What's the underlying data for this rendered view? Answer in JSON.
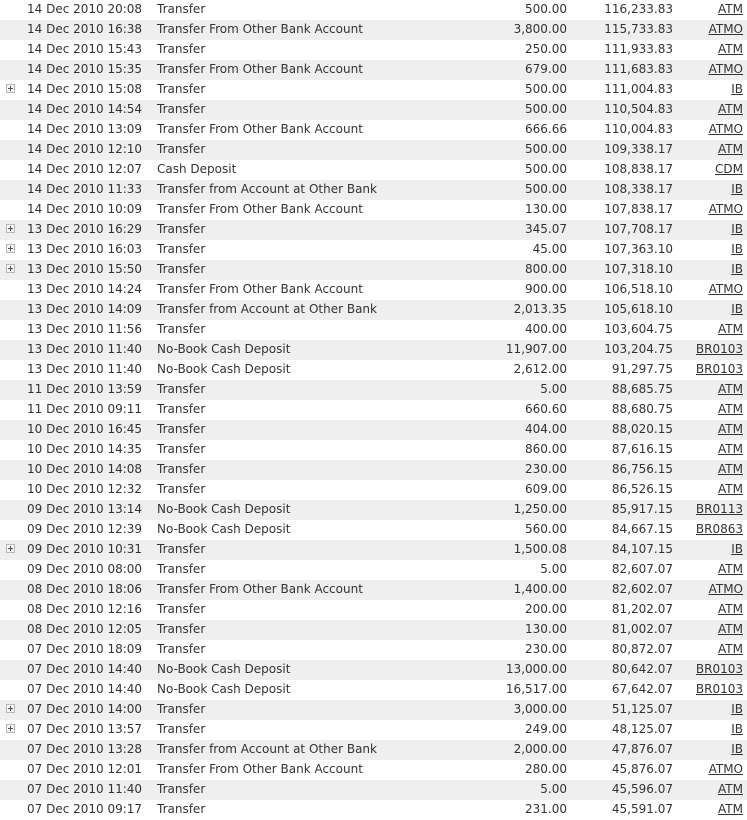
{
  "transactions": [
    {
      "date": "14 Dec 2010 20:08",
      "description": "Transfer",
      "amount": "500.00",
      "balance": "116,233.83",
      "channel": "ATM",
      "expandable": false
    },
    {
      "date": "14 Dec 2010 16:38",
      "description": "Transfer From Other Bank Account",
      "amount": "3,800.00",
      "balance": "115,733.83",
      "channel": "ATMO",
      "expandable": false
    },
    {
      "date": "14 Dec 2010 15:43",
      "description": "Transfer",
      "amount": "250.00",
      "balance": "111,933.83",
      "channel": "ATM",
      "expandable": false
    },
    {
      "date": "14 Dec 2010 15:35",
      "description": "Transfer From Other Bank Account",
      "amount": "679.00",
      "balance": "111,683.83",
      "channel": "ATMO",
      "expandable": false
    },
    {
      "date": "14 Dec 2010 15:08",
      "description": "Transfer",
      "amount": "500.00",
      "balance": "111,004.83",
      "channel": "IB",
      "expandable": true
    },
    {
      "date": "14 Dec 2010 14:54",
      "description": "Transfer",
      "amount": "500.00",
      "balance": "110,504.83",
      "channel": "ATM",
      "expandable": false
    },
    {
      "date": "14 Dec 2010 13:09",
      "description": "Transfer From Other Bank Account",
      "amount": "666.66",
      "balance": "110,004.83",
      "channel": "ATMO",
      "expandable": false
    },
    {
      "date": "14 Dec 2010 12:10",
      "description": "Transfer",
      "amount": "500.00",
      "balance": "109,338.17",
      "channel": "ATM",
      "expandable": false
    },
    {
      "date": "14 Dec 2010 12:07",
      "description": "Cash Deposit",
      "amount": "500.00",
      "balance": "108,838.17",
      "channel": "CDM",
      "expandable": false
    },
    {
      "date": "14 Dec 2010 11:33",
      "description": "Transfer from Account at Other Bank",
      "amount": "500.00",
      "balance": "108,338.17",
      "channel": "IB",
      "expandable": false
    },
    {
      "date": "14 Dec 2010 10:09",
      "description": "Transfer From Other Bank Account",
      "amount": "130.00",
      "balance": "107,838.17",
      "channel": "ATMO",
      "expandable": false
    },
    {
      "date": "13 Dec 2010 16:29",
      "description": "Transfer",
      "amount": "345.07",
      "balance": "107,708.17",
      "channel": "IB",
      "expandable": true
    },
    {
      "date": "13 Dec 2010 16:03",
      "description": "Transfer",
      "amount": "45.00",
      "balance": "107,363.10",
      "channel": "IB",
      "expandable": true
    },
    {
      "date": "13 Dec 2010 15:50",
      "description": "Transfer",
      "amount": "800.00",
      "balance": "107,318.10",
      "channel": "IB",
      "expandable": true
    },
    {
      "date": "13 Dec 2010 14:24",
      "description": "Transfer From Other Bank Account",
      "amount": "900.00",
      "balance": "106,518.10",
      "channel": "ATMO",
      "expandable": false
    },
    {
      "date": "13 Dec 2010 14:09",
      "description": "Transfer from Account at Other Bank",
      "amount": "2,013.35",
      "balance": "105,618.10",
      "channel": "IB",
      "expandable": false
    },
    {
      "date": "13 Dec 2010 11:56",
      "description": "Transfer",
      "amount": "400.00",
      "balance": "103,604.75",
      "channel": "ATM",
      "expandable": false
    },
    {
      "date": "13 Dec 2010 11:40",
      "description": "No-Book Cash Deposit",
      "amount": "11,907.00",
      "balance": "103,204.75",
      "channel": "BR0103",
      "expandable": false
    },
    {
      "date": "13 Dec 2010 11:40",
      "description": "No-Book Cash Deposit",
      "amount": "2,612.00",
      "balance": "91,297.75",
      "channel": "BR0103",
      "expandable": false
    },
    {
      "date": "11 Dec 2010 13:59",
      "description": "Transfer",
      "amount": "5.00",
      "balance": "88,685.75",
      "channel": "ATM",
      "expandable": false
    },
    {
      "date": "11 Dec 2010 09:11",
      "description": "Transfer",
      "amount": "660.60",
      "balance": "88,680.75",
      "channel": "ATM",
      "expandable": false
    },
    {
      "date": "10 Dec 2010 16:45",
      "description": "Transfer",
      "amount": "404.00",
      "balance": "88,020.15",
      "channel": "ATM",
      "expandable": false
    },
    {
      "date": "10 Dec 2010 14:35",
      "description": "Transfer",
      "amount": "860.00",
      "balance": "87,616.15",
      "channel": "ATM",
      "expandable": false
    },
    {
      "date": "10 Dec 2010 14:08",
      "description": "Transfer",
      "amount": "230.00",
      "balance": "86,756.15",
      "channel": "ATM",
      "expandable": false
    },
    {
      "date": "10 Dec 2010 12:32",
      "description": "Transfer",
      "amount": "609.00",
      "balance": "86,526.15",
      "channel": "ATM",
      "expandable": false
    },
    {
      "date": "09 Dec 2010 13:14",
      "description": "No-Book Cash Deposit",
      "amount": "1,250.00",
      "balance": "85,917.15",
      "channel": "BR0113",
      "expandable": false
    },
    {
      "date": "09 Dec 2010 12:39",
      "description": "No-Book Cash Deposit",
      "amount": "560.00",
      "balance": "84,667.15",
      "channel": "BR0863",
      "expandable": false
    },
    {
      "date": "09 Dec 2010 10:31",
      "description": "Transfer",
      "amount": "1,500.08",
      "balance": "84,107.15",
      "channel": "IB",
      "expandable": true
    },
    {
      "date": "09 Dec 2010 08:00",
      "description": "Transfer",
      "amount": "5.00",
      "balance": "82,607.07",
      "channel": "ATM",
      "expandable": false
    },
    {
      "date": "08 Dec 2010 18:06",
      "description": "Transfer From Other Bank Account",
      "amount": "1,400.00",
      "balance": "82,602.07",
      "channel": "ATMO",
      "expandable": false
    },
    {
      "date": "08 Dec 2010 12:16",
      "description": "Transfer",
      "amount": "200.00",
      "balance": "81,202.07",
      "channel": "ATM",
      "expandable": false
    },
    {
      "date": "08 Dec 2010 12:05",
      "description": "Transfer",
      "amount": "130.00",
      "balance": "81,002.07",
      "channel": "ATM",
      "expandable": false
    },
    {
      "date": "07 Dec 2010 18:09",
      "description": "Transfer",
      "amount": "230.00",
      "balance": "80,872.07",
      "channel": "ATM",
      "expandable": false
    },
    {
      "date": "07 Dec 2010 14:40",
      "description": "No-Book Cash Deposit",
      "amount": "13,000.00",
      "balance": "80,642.07",
      "channel": "BR0103",
      "expandable": false
    },
    {
      "date": "07 Dec 2010 14:40",
      "description": "No-Book Cash Deposit",
      "amount": "16,517.00",
      "balance": "67,642.07",
      "channel": "BR0103",
      "expandable": false
    },
    {
      "date": "07 Dec 2010 14:00",
      "description": "Transfer",
      "amount": "3,000.00",
      "balance": "51,125.07",
      "channel": "IB",
      "expandable": true
    },
    {
      "date": "07 Dec 2010 13:57",
      "description": "Transfer",
      "amount": "249.00",
      "balance": "48,125.07",
      "channel": "IB",
      "expandable": true
    },
    {
      "date": "07 Dec 2010 13:28",
      "description": "Transfer from Account at Other Bank",
      "amount": "2,000.00",
      "balance": "47,876.07",
      "channel": "IB",
      "expandable": false
    },
    {
      "date": "07 Dec 2010 12:01",
      "description": "Transfer From Other Bank Account",
      "amount": "280.00",
      "balance": "45,876.07",
      "channel": "ATMO",
      "expandable": false
    },
    {
      "date": "07 Dec 2010 11:40",
      "description": "Transfer",
      "amount": "5.00",
      "balance": "45,596.07",
      "channel": "ATM",
      "expandable": false
    },
    {
      "date": "07 Dec 2010 09:17",
      "description": "Transfer",
      "amount": "231.00",
      "balance": "45,591.07",
      "channel": "ATM",
      "expandable": false
    }
  ],
  "colors": {
    "row_alt_bg": "#efefef",
    "row_bg": "#ffffff",
    "text": "#333333"
  },
  "icons": {
    "expand": "expand-plus-icon"
  }
}
